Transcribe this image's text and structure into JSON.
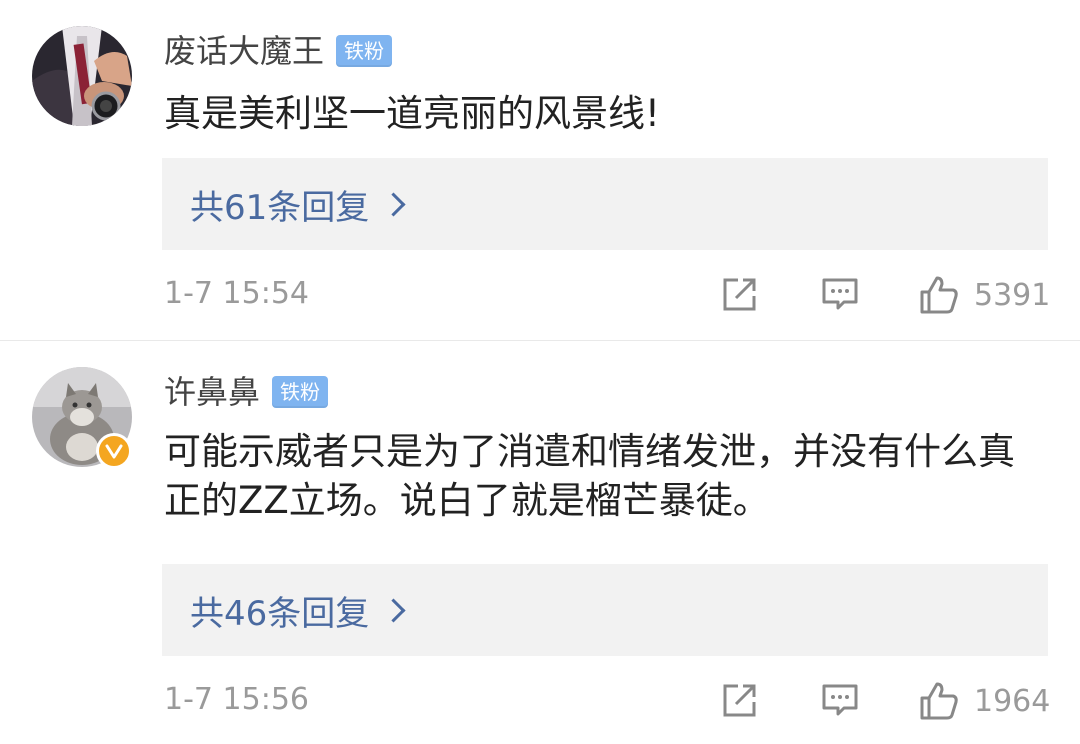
{
  "comments": [
    {
      "username": "废话大魔王",
      "badge": "铁粉",
      "verified": false,
      "content": "真是美利坚一道亮丽的风景线!",
      "reply_link": "共61条回复",
      "time": "1-7 15:54",
      "like_count": "5391",
      "avatar_icon": "avatar-suit-watch"
    },
    {
      "username": "许鼻鼻",
      "badge": "铁粉",
      "verified": true,
      "content": "可能示威者只是为了消遣和情绪发泄，并没有什么真正的ZZ立场。说白了就是榴芒暴徒。",
      "reply_link": "共46条回复",
      "time": "1-7 15:56",
      "like_count": "1964",
      "avatar_icon": "avatar-cat"
    }
  ],
  "icons": {
    "share": "share-icon",
    "comment": "comment-icon",
    "like": "thumbs-up-icon",
    "chevron": "chevron-right-icon",
    "verified": "verified-badge-icon"
  },
  "colors": {
    "badge": "#7fb4f0",
    "reply_link": "#4a6aa0",
    "reply_bg": "#f2f2f2",
    "meta_text": "#9a9a9a",
    "verified": "#f4a620"
  }
}
